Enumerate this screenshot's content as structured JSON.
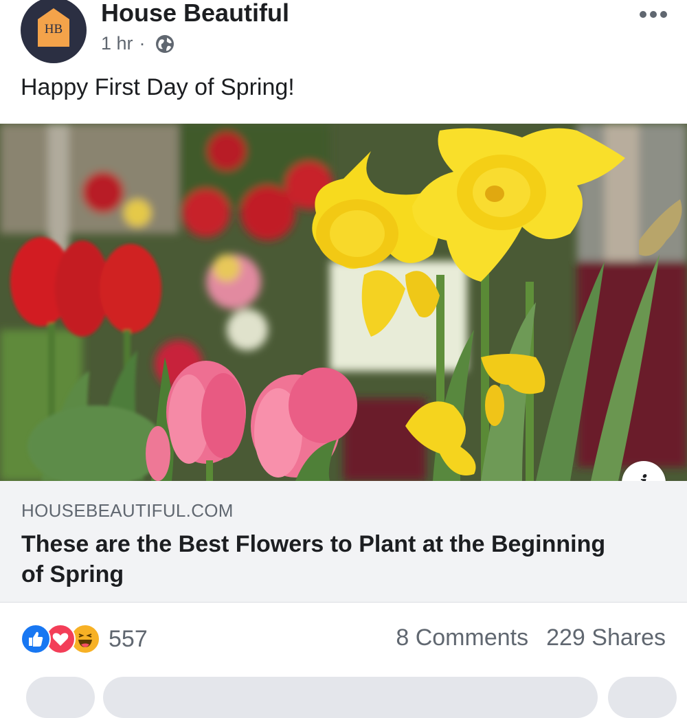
{
  "post": {
    "page_name": "House Beautiful",
    "avatar_text": "HB",
    "time": "1 hr",
    "separator": "·",
    "caption": "Happy First Day of Spring!"
  },
  "icons": {
    "globe": "globe-icon",
    "more": "more-options-icon",
    "info": "info-icon",
    "reactions": [
      "like-icon",
      "love-icon",
      "haha-icon"
    ]
  },
  "link": {
    "domain": "HOUSEBEAUTIFUL.COM",
    "title": "These are the Best Flowers to Plant at the Beginning of Spring",
    "info_glyph": "i"
  },
  "engagement": {
    "reaction_count": "557",
    "comments": "8 Comments",
    "shares": "229 Shares"
  },
  "colors": {
    "avatar_bg": "#2b2f42",
    "avatar_house": "#f4a34a",
    "link_bg": "#f2f3f5",
    "meta_text": "#606770",
    "like": "#1877f2",
    "love": "#f33e58",
    "haha": "#f7b125"
  }
}
